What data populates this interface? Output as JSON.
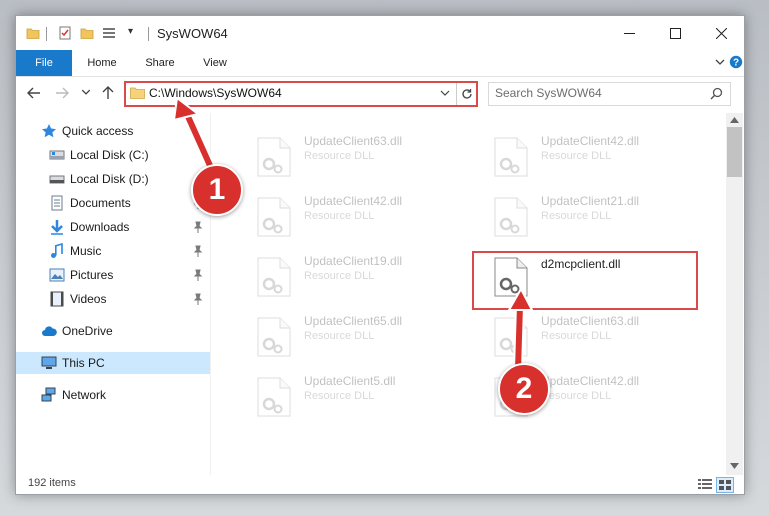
{
  "window": {
    "title": "SysWOW64",
    "controls": {
      "minimize": "minimize-icon",
      "maximize": "maximize-icon",
      "close": "close-icon"
    }
  },
  "ribbon": {
    "tabs": [
      {
        "label": "File",
        "active": true
      },
      {
        "label": "Home"
      },
      {
        "label": "Share"
      },
      {
        "label": "View"
      }
    ]
  },
  "address": {
    "path": "C:\\Windows\\SysWOW64"
  },
  "search": {
    "placeholder": "Search SysWOW64"
  },
  "sidebar": {
    "items": [
      {
        "label": "Quick access",
        "icon": "star-icon"
      },
      {
        "label": "Local Disk (C:)",
        "icon": "drive-icon"
      },
      {
        "label": "Local Disk (D:)",
        "icon": "drive-icon"
      },
      {
        "label": "Documents",
        "icon": "documents-icon",
        "pinned": true
      },
      {
        "label": "Downloads",
        "icon": "download-icon",
        "pinned": true
      },
      {
        "label": "Music",
        "icon": "music-icon",
        "pinned": true
      },
      {
        "label": "Pictures",
        "icon": "pictures-icon",
        "pinned": true
      },
      {
        "label": "Videos",
        "icon": "videos-icon",
        "pinned": true
      },
      {
        "label": "OneDrive",
        "icon": "cloud-icon"
      },
      {
        "label": "This PC",
        "icon": "computer-icon",
        "selected": true
      },
      {
        "label": "Network",
        "icon": "network-icon"
      }
    ]
  },
  "files": [
    {
      "name": "UpdateClient63.dll",
      "type": "Resource DLL",
      "faded": true
    },
    {
      "name": "UpdateClient42.dll",
      "type": "Resource DLL",
      "faded": true
    },
    {
      "name": "UpdateClient42.dll",
      "type": "Resource DLL",
      "faded": true
    },
    {
      "name": "UpdateClient21.dll",
      "type": "Resource DLL",
      "faded": true
    },
    {
      "name": "UpdateClient19.dll",
      "type": "Resource DLL",
      "faded": true
    },
    {
      "name": "d2mcpclient.dll",
      "type": "",
      "faded": false,
      "highlighted": true
    },
    {
      "name": "UpdateClient65.dll",
      "type": "Resource DLL",
      "faded": true
    },
    {
      "name": "UpdateClient63.dll",
      "type": "Resource DLL",
      "faded": true
    },
    {
      "name": "UpdateClient5.dll",
      "type": "Resource DLL",
      "faded": true
    },
    {
      "name": "UpdateClient42.dll",
      "type": "Resource DLL",
      "faded": true
    }
  ],
  "status": {
    "item_count": "192 items"
  },
  "annotations": {
    "callout_1": "1",
    "callout_2": "2",
    "highlight_color": "#d94a4a",
    "callout_color": "#d8302d"
  },
  "colors": {
    "file_tab": "#1979ca",
    "selected_nav": "#cce8ff"
  }
}
